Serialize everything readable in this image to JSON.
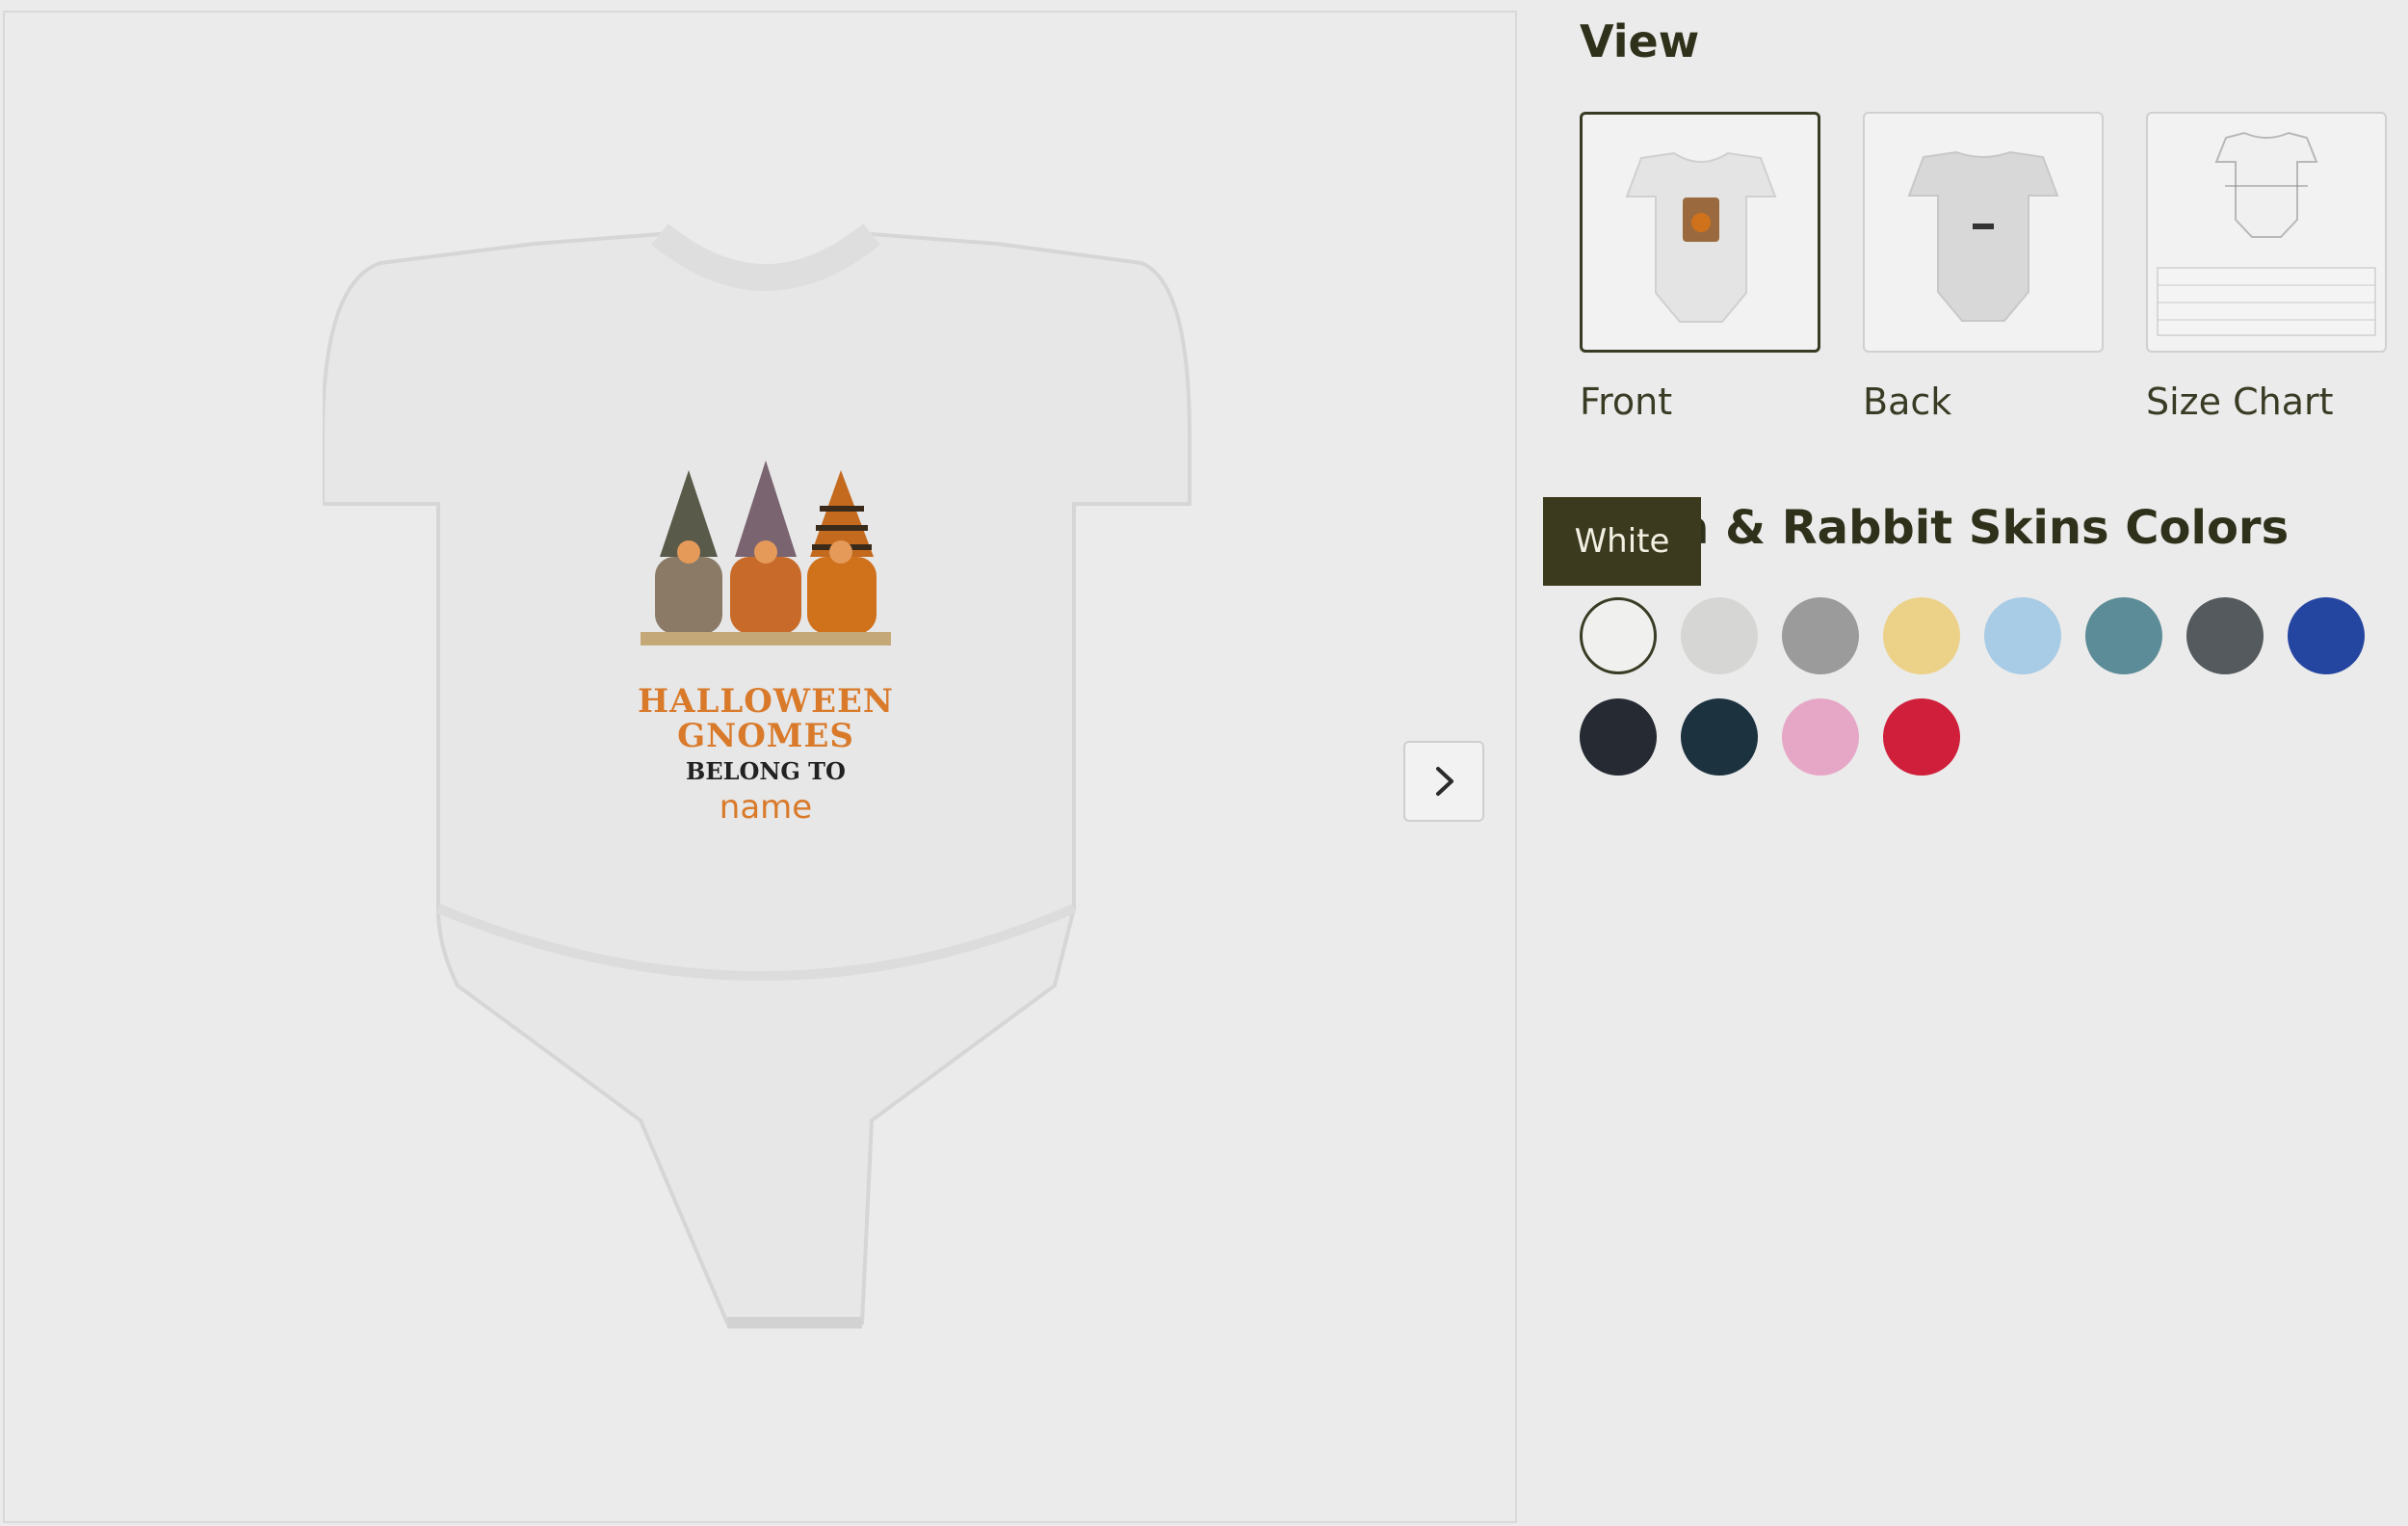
{
  "product": {
    "design_text": {
      "line1": "HALLOWEEN",
      "line2": "GNOMES",
      "line3": "BELONG TO",
      "line4": "name"
    },
    "next_button_icon": "chevron-right-icon"
  },
  "view": {
    "title": "View",
    "thumbnails": [
      {
        "label": "Front"
      },
      {
        "label": "Back"
      },
      {
        "label": "Size Chart"
      }
    ]
  },
  "colors": {
    "title": "Bella & Rabbit Skins Colors",
    "tooltip": "White",
    "swatches": [
      {
        "name": "White",
        "hex": "#f0f0ee"
      },
      {
        "name": "Light Gray",
        "hex": "#d6d6d4"
      },
      {
        "name": "Heather Gray",
        "hex": "#9b9b9b"
      },
      {
        "name": "Yellow",
        "hex": "#ecd289"
      },
      {
        "name": "Light Blue",
        "hex": "#a8cbe6"
      },
      {
        "name": "Teal",
        "hex": "#5c8c97"
      },
      {
        "name": "Charcoal",
        "hex": "#545a5d"
      },
      {
        "name": "Royal Blue",
        "hex": "#2546a0"
      },
      {
        "name": "Black",
        "hex": "#262b33"
      },
      {
        "name": "Navy",
        "hex": "#1c323f"
      },
      {
        "name": "Pink",
        "hex": "#e6a7c7"
      },
      {
        "name": "Red",
        "hex": "#cf1f3a"
      }
    ]
  },
  "accent_color": "#3a3b24"
}
